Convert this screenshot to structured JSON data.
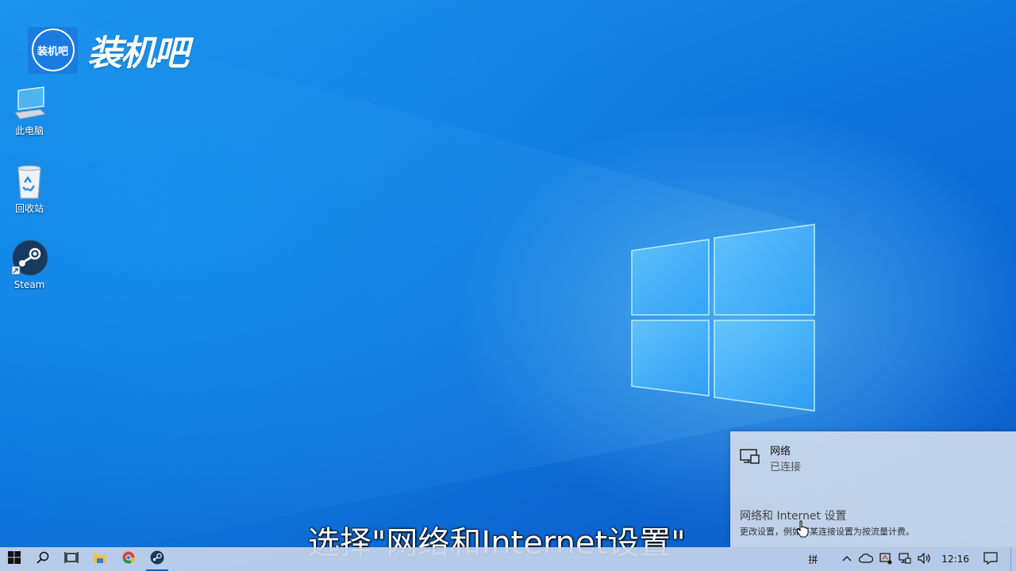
{
  "brand": {
    "badge_text": "装机吧",
    "text": "装机吧"
  },
  "desktop_icons": [
    {
      "label": "此电脑",
      "icon": "computer-icon"
    },
    {
      "label": "回收站",
      "icon": "recycle-bin-icon"
    },
    {
      "label": "Steam",
      "icon": "steam-icon"
    }
  ],
  "network_flyout": {
    "title": "网络",
    "status": "已连接",
    "settings_link": "网络和 Internet 设置",
    "settings_desc": "更改设置，例如将某连接设置为按流量计费。"
  },
  "subtitle": "选择\"网络和Internet设置\"",
  "taskbar": {
    "pinned": [
      "start-icon",
      "search-icon",
      "task-view-icon",
      "file-explorer-icon",
      "chrome-icon",
      "steam-icon"
    ],
    "ime": "拼",
    "clock": "12:16"
  },
  "colors": {
    "accent": "#0a6fd8",
    "taskbar": "#c4d4ec"
  }
}
